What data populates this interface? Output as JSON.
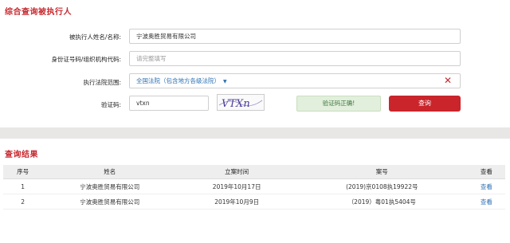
{
  "header": {
    "title": "综合查询被执行人"
  },
  "form": {
    "name_label": "被执行人姓名/名称:",
    "name_value": "宁波奥胜贸易有限公司",
    "id_label": "身份证号码/组织机构代码:",
    "id_placeholder": "请完整填写",
    "court_label": "执行法院范围:",
    "court_value": "全国法院（包含地方各级法院）",
    "captcha_label": "验证码:",
    "captcha_value": "vtxn",
    "captcha_image_text": "VTXn",
    "captcha_ok": "验证码正确!",
    "query_button": "查询"
  },
  "results": {
    "title": "查询结果",
    "columns": [
      "序号",
      "姓名",
      "立案时间",
      "案号",
      "查看"
    ],
    "rows": [
      {
        "no": "1",
        "name": "宁波奥胜贸易有限公司",
        "date": "2019年10月17日",
        "case": "(2019)京0108执19922号",
        "view": "查看"
      },
      {
        "no": "2",
        "name": "宁波奥胜贸易有限公司",
        "date": "2019年10月9日",
        "case": "（2019）粤01执5404号",
        "view": "查看"
      }
    ]
  },
  "colors": {
    "brand": "#c7282e",
    "link": "#2b6fb3",
    "success_bg": "#e2efdc"
  }
}
